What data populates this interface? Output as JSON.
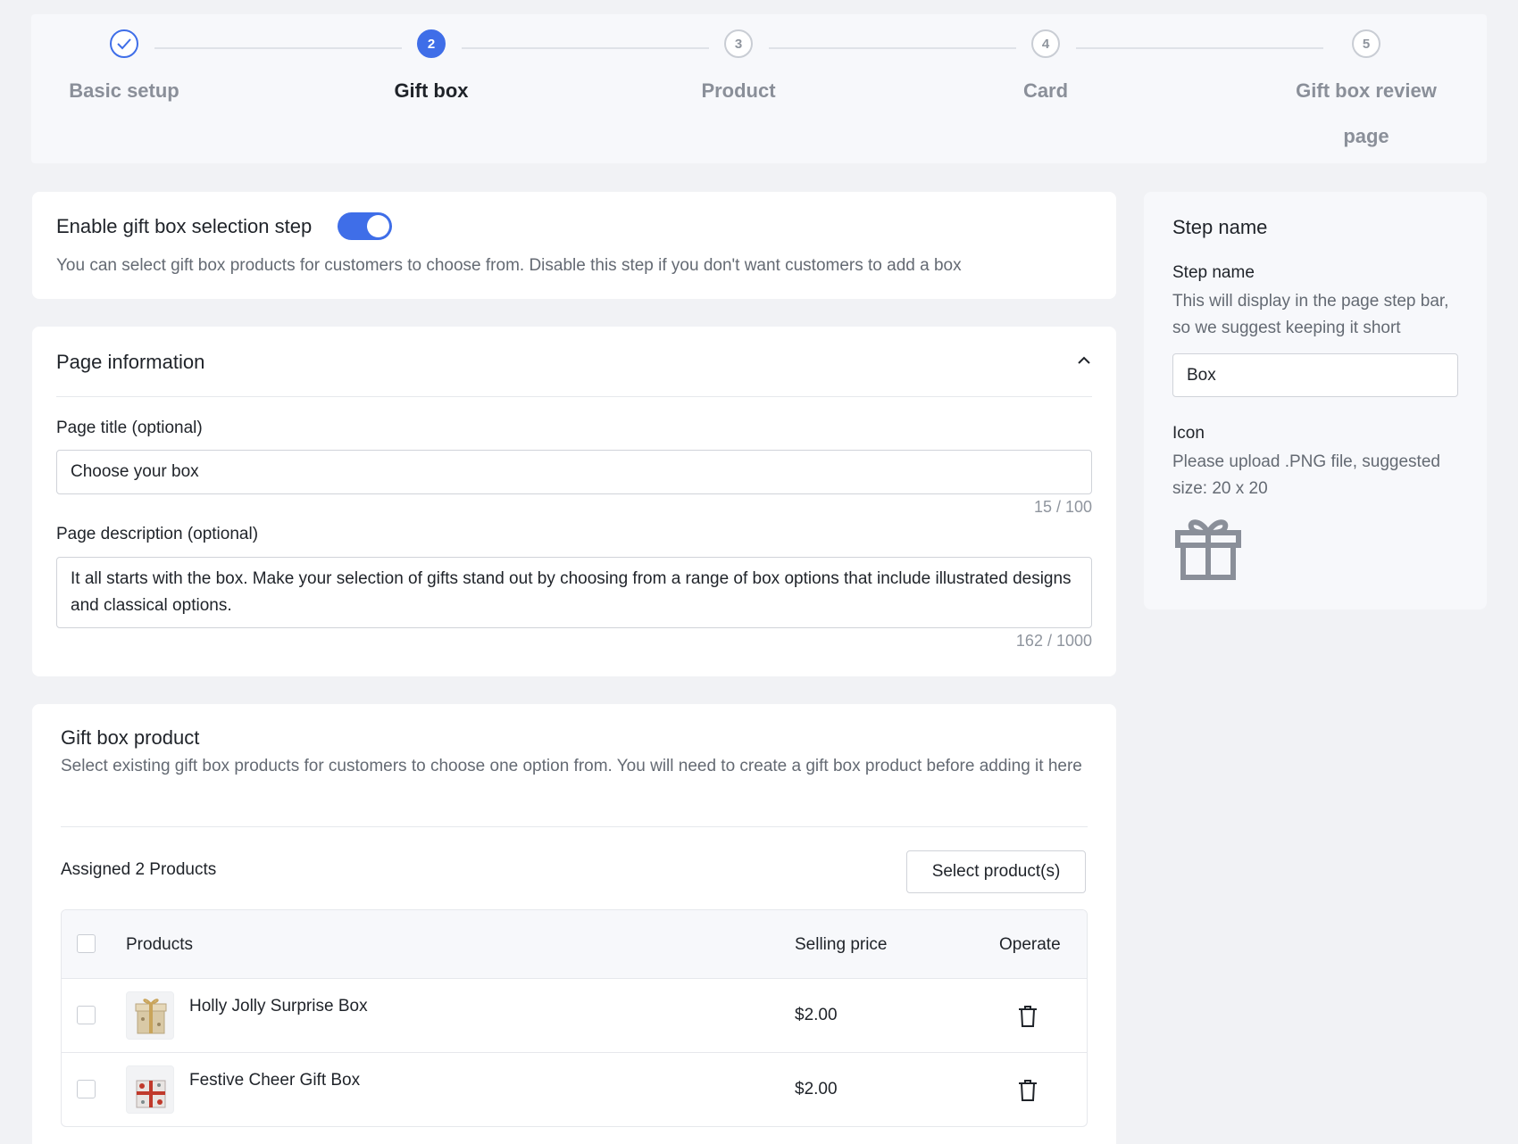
{
  "stepper": {
    "steps": [
      {
        "marker": "",
        "label": "Basic setup",
        "state": "done"
      },
      {
        "marker": "2",
        "label": "Gift box",
        "state": "active"
      },
      {
        "marker": "3",
        "label": "Product",
        "state": "pending"
      },
      {
        "marker": "4",
        "label": "Card",
        "state": "pending"
      },
      {
        "marker": "5",
        "label": "Gift box review",
        "label2": "page",
        "state": "pending"
      }
    ]
  },
  "enable_card": {
    "title": "Enable gift box selection step",
    "toggle_on": true,
    "description": "You can select gift box products for customers to choose from. Disable this step if you don't want customers to add a box"
  },
  "page_info": {
    "title": "Page information",
    "page_title_label": "Page title (optional)",
    "page_title_value": "Choose your box",
    "page_title_counter": "15 / 100",
    "page_desc_label": "Page description (optional)",
    "page_desc_value": "It all starts with the box. Make your selection of gifts stand out by choosing from a range of box options that include illustrated designs and classical options.",
    "page_desc_counter": "162 / 1000"
  },
  "gift_box_product": {
    "title": "Gift box product",
    "description": "Select existing gift box products for customers to choose one option from. You will need to create a gift box product before adding it here",
    "assigned_label": "Assigned 2 Products",
    "select_button": "Select product(s)",
    "table": {
      "headers": {
        "products": "Products",
        "price": "Selling price",
        "operate": "Operate"
      },
      "rows": [
        {
          "name": "Holly Jolly Surprise Box",
          "price": "$2.00"
        },
        {
          "name": "Festive Cheer Gift Box",
          "price": "$2.00"
        }
      ]
    }
  },
  "side_panel": {
    "title": "Step name",
    "step_name_label": "Step name",
    "step_name_help": "This will display in the page step bar, so we suggest keeping it short",
    "step_name_value": "Box",
    "icon_label": "Icon",
    "icon_help": "Please upload .PNG file, suggested size: 20 x 20",
    "icon_name": "gift-icon"
  },
  "colors": {
    "accent": "#3f6ee8",
    "background": "#f1f2f5"
  }
}
